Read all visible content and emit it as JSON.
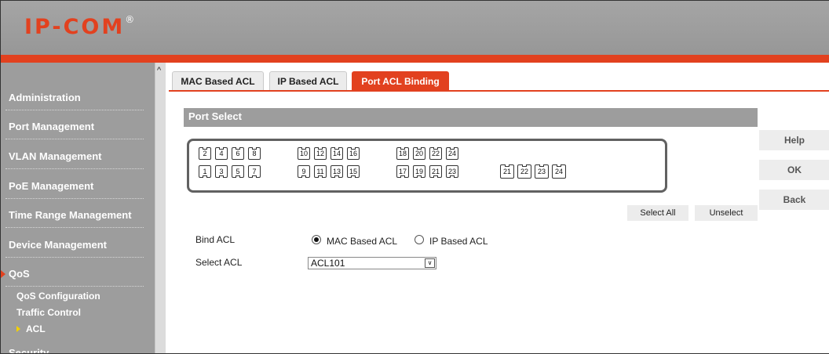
{
  "header": {
    "logo": "IP-COM",
    "logo_mark": "®"
  },
  "sidebar": {
    "items": [
      {
        "label": "Administration"
      },
      {
        "label": "Port Management"
      },
      {
        "label": "VLAN Management"
      },
      {
        "label": "PoE Management"
      },
      {
        "label": "Time Range Management"
      },
      {
        "label": "Device Management"
      },
      {
        "label": "QoS"
      },
      {
        "label": "Security"
      }
    ],
    "sub_items": [
      {
        "label": "QoS Configuration"
      },
      {
        "label": "Traffic Control"
      },
      {
        "label": "ACL"
      }
    ]
  },
  "tabs": [
    {
      "label": "MAC Based ACL"
    },
    {
      "label": "IP Based ACL"
    },
    {
      "label": "Port ACL Binding"
    }
  ],
  "port_select": {
    "title": "Port Select",
    "top_row": [
      "2",
      "4",
      "6",
      "8",
      "10",
      "12",
      "14",
      "16",
      "18",
      "20",
      "22",
      "24"
    ],
    "bottom_row": [
      "1",
      "3",
      "5",
      "7",
      "9",
      "11",
      "13",
      "15",
      "17",
      "19",
      "21",
      "23"
    ],
    "sfp": [
      "21",
      "22",
      "23",
      "24"
    ],
    "select_all": "Select All",
    "unselect": "Unselect"
  },
  "side_buttons": {
    "help": "Help",
    "ok": "OK",
    "back": "Back"
  },
  "form": {
    "bind_acl_label": "Bind ACL",
    "options": {
      "mac": "MAC Based ACL",
      "ip": "IP Based ACL"
    },
    "selected_option": "MAC Based ACL",
    "select_acl_label": "Select ACL",
    "select_acl_value": "ACL101"
  },
  "colors": {
    "accent": "#e2411f",
    "sidebar": "#9d9d9d",
    "header": "#a0a0a0"
  },
  "icons": {
    "scroll_up": "chevron-up-icon",
    "dropdown": "chevron-down-icon",
    "nav_active": "triangle-right-icon"
  }
}
